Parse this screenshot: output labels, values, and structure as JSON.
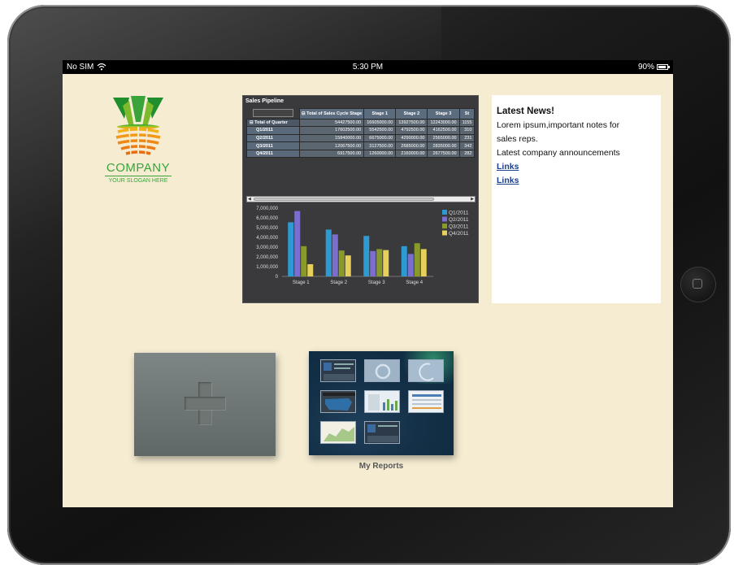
{
  "status_bar": {
    "carrier": "No SIM",
    "time": "5:30 PM",
    "battery": "90%"
  },
  "logo": {
    "name": "COMPANY",
    "slogan": "YOUR SLOGAN HERE"
  },
  "pipeline": {
    "title": "Sales Pipeline",
    "header": [
      "Total of Sales Cycle Stage",
      "Stage 1",
      "Stage 2",
      "Stage 3",
      "St"
    ],
    "rows": [
      {
        "label": "Total of Quarter",
        "cells": [
          "54427500.00",
          "16605000.00",
          "13927500.00",
          "12243000.00",
          "1155"
        ]
      },
      {
        "label": "Q1/2011",
        "cells": [
          "17602500.00",
          "5542500.00",
          "4792500.00",
          "4162500.00",
          "310"
        ]
      },
      {
        "label": "Q2/2011",
        "cells": [
          "15840000.00",
          "6675000.00",
          "4290000.00",
          "2565000.00",
          "231"
        ]
      },
      {
        "label": "Q3/2011",
        "cells": [
          "12067500.00",
          "3127500.00",
          "2685000.00",
          "2835000.00",
          "342"
        ]
      },
      {
        "label": "Q4/2011",
        "cells": [
          "6917500.00",
          "1260000.00",
          "2160000.00",
          "2677500.00",
          "282"
        ]
      }
    ]
  },
  "chart_data": {
    "type": "bar",
    "categories": [
      "Stage 1",
      "Stage 2",
      "Stage 3",
      "Stage 4"
    ],
    "series": [
      {
        "name": "Q1/2011",
        "values": [
          5550000,
          4800000,
          4150000,
          3100000
        ]
      },
      {
        "name": "Q2/2011",
        "values": [
          6700000,
          4300000,
          2600000,
          2300000
        ]
      },
      {
        "name": "Q3/2011",
        "values": [
          3100000,
          2650000,
          2800000,
          3400000
        ]
      },
      {
        "name": "Q4/2011",
        "values": [
          1250000,
          2150000,
          2700000,
          2800000
        ]
      }
    ],
    "ytick_labels": [
      "7,000,000",
      "6,000,000",
      "5,000,000",
      "4,000,000",
      "3,000,000",
      "2,000,000",
      "1,000,000",
      "0"
    ],
    "yticks": [
      7000000,
      6000000,
      5000000,
      4000000,
      3000000,
      2000000,
      1000000,
      0
    ],
    "ylim": [
      0,
      7000000
    ],
    "colors": [
      "#2e9ad2",
      "#7a6fd0",
      "#8a9a2a",
      "#e6cf5a"
    ],
    "legend_position": "right",
    "grid": false
  },
  "news": {
    "title": "Latest News!",
    "lines": [
      "Lorem ipsum,important notes for",
      "sales reps.",
      "Latest company announcements"
    ],
    "links": [
      "Links",
      "Links"
    ]
  },
  "tiles": {
    "reports_label": "My Reports"
  }
}
